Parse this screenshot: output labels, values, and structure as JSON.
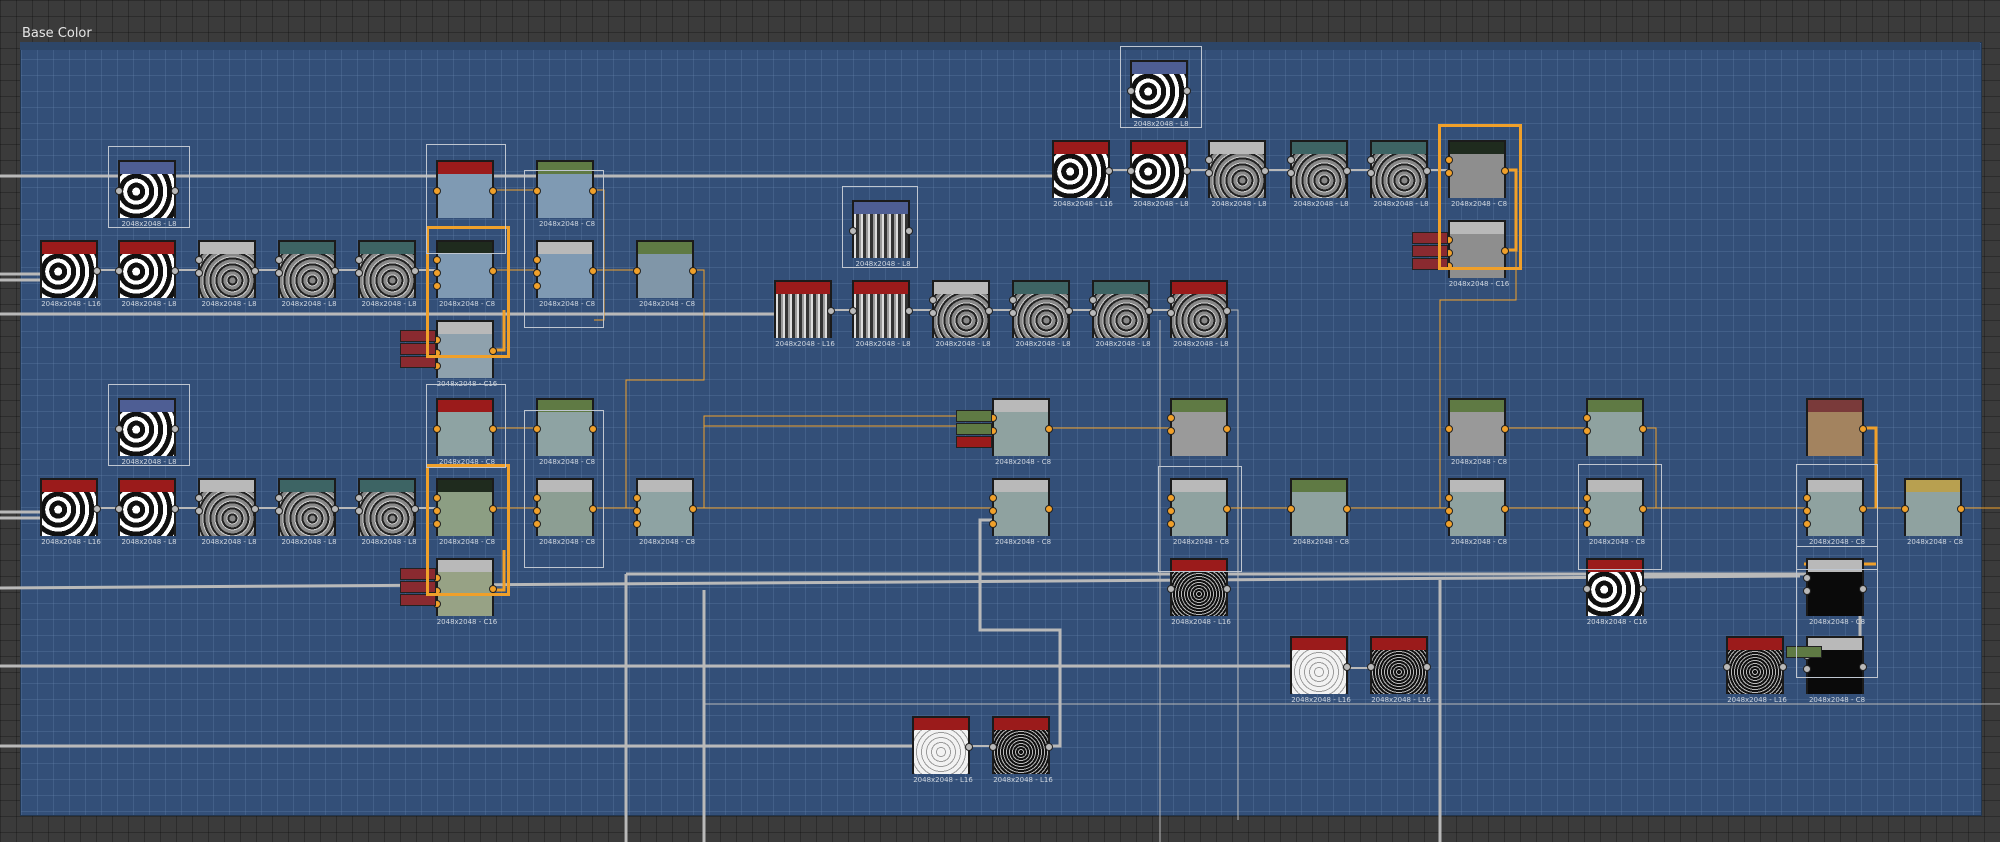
{
  "frame": {
    "title": "Base Color"
  },
  "colors": {
    "frame": "#334f78",
    "header_red": "#9b1b1b",
    "header_teal": "#3d6464",
    "header_gray": "#b9b9b9",
    "header_green": "#5f7a44",
    "header_dark": "#1f2b1e",
    "header_blue": "#4e5e94",
    "header_brown": "#7a3a3a",
    "header_gold": "#b8a050",
    "wire_gray": "#b9b9b9",
    "wire_orange": "#f0a02a"
  },
  "nodes": [
    {
      "id": "n01",
      "label": "2048x2048 - L8",
      "header": "#4e5e94",
      "body": "noise1"
    },
    {
      "id": "n02",
      "label": "2048x2048 - L16",
      "header": "#9b1b1b",
      "body": "noise1"
    },
    {
      "id": "n03",
      "label": "2048x2048 - L8",
      "header": "#9b1b1b",
      "body": "noise1"
    },
    {
      "id": "n04",
      "label": "2048x2048 - L8",
      "header": "#b9b9b9",
      "body": "noise3"
    },
    {
      "id": "n05",
      "label": "2048x2048 - L8",
      "header": "#3d6464",
      "body": "noise3"
    },
    {
      "id": "n06",
      "label": "2048x2048 - L8",
      "header": "#3d6464",
      "body": "noise3"
    },
    {
      "id": "n07",
      "label": "",
      "header": "#9b1b1b",
      "body": "#7f9ab3"
    },
    {
      "id": "n08",
      "label": "2048x2048 - C8",
      "header": "#1f2b1e",
      "body": "#7f9ab3"
    },
    {
      "id": "n09",
      "label": "2048x2048 - C16",
      "header": "#b9b9b9",
      "body": "#8ea1ad"
    },
    {
      "id": "n10",
      "label": "2048x2048 - C8",
      "header": "#5f7a44",
      "body": "#7f9ab3"
    },
    {
      "id": "n11",
      "label": "2048x2048 - C8",
      "header": "#b9b9b9",
      "body": "#7f9ab3"
    },
    {
      "id": "n12",
      "label": "2048x2048 - C8",
      "header": "#5f7a44",
      "body": "#8096a8"
    },
    {
      "id": "n13",
      "label": "2048x2048 - L8",
      "header": "#4e5e94",
      "body": "noise1"
    },
    {
      "id": "n14",
      "label": "2048x2048 - L16",
      "header": "#9b1b1b",
      "body": "noise1"
    },
    {
      "id": "n15",
      "label": "2048x2048 - L8",
      "header": "#9b1b1b",
      "body": "noise1"
    },
    {
      "id": "n16",
      "label": "2048x2048 - L8",
      "header": "#b9b9b9",
      "body": "noise3"
    },
    {
      "id": "n17",
      "label": "2048x2048 - L8",
      "header": "#3d6464",
      "body": "noise3"
    },
    {
      "id": "n18",
      "label": "2048x2048 - L8",
      "header": "#3d6464",
      "body": "noise3"
    },
    {
      "id": "n19",
      "label": "2048x2048 - C8",
      "header": "#9b1b1b",
      "body": "#8ea3a3"
    },
    {
      "id": "n20",
      "label": "2048x2048 - C8",
      "header": "#1f2b1e",
      "body": "#8c9e83"
    },
    {
      "id": "n21",
      "label": "2048x2048 - C16",
      "header": "#b9b9b9",
      "body": "#97a285"
    },
    {
      "id": "n22",
      "label": "2048x2048 - C8",
      "header": "#5f7a44",
      "body": "#8ea3a3"
    },
    {
      "id": "n23",
      "label": "2048x2048 - C8",
      "header": "#b9b9b9",
      "body": "#8c9e93"
    },
    {
      "id": "n24",
      "label": "2048x2048 - C8",
      "header": "#b9b9b9",
      "body": "#8ea3a3"
    },
    {
      "id": "n25",
      "label": "2048x2048 - L8",
      "header": "#4e5e94",
      "body": "noise2"
    },
    {
      "id": "n26",
      "label": "2048x2048 - L16",
      "header": "#9b1b1b",
      "body": "noise2"
    },
    {
      "id": "n27",
      "label": "2048x2048 - L8",
      "header": "#9b1b1b",
      "body": "noise2"
    },
    {
      "id": "n28",
      "label": "2048x2048 - L8",
      "header": "#b9b9b9",
      "body": "noise3"
    },
    {
      "id": "n29",
      "label": "2048x2048 - L8",
      "header": "#3d6464",
      "body": "noise3"
    },
    {
      "id": "n30",
      "label": "2048x2048 - L8",
      "header": "#3d6464",
      "body": "noise3"
    },
    {
      "id": "n31",
      "label": "2048x2048 - L8",
      "header": "#9b1b1b",
      "body": "noise3"
    },
    {
      "id": "n32",
      "label": "2048x2048 - C8",
      "header": "#b9b9b9",
      "body": "#8fa2a0"
    },
    {
      "id": "n33",
      "label": "2048x2048 - C8",
      "header": "#b9b9b9",
      "body": "#8fa2a0"
    },
    {
      "id": "n34",
      "label": "2048x2048 - L8",
      "header": "#4e5e94",
      "body": "noise1"
    },
    {
      "id": "n35",
      "label": "2048x2048 - L16",
      "header": "#9b1b1b",
      "body": "noise1"
    },
    {
      "id": "n36",
      "label": "2048x2048 - L8",
      "header": "#9b1b1b",
      "body": "noise1"
    },
    {
      "id": "n37",
      "label": "2048x2048 - L8",
      "header": "#b9b9b9",
      "body": "noise3"
    },
    {
      "id": "n38",
      "label": "2048x2048 - L8",
      "header": "#3d6464",
      "body": "noise3"
    },
    {
      "id": "n39",
      "label": "2048x2048 - L8",
      "header": "#3d6464",
      "body": "noise3"
    },
    {
      "id": "n40",
      "label": "2048x2048 - C8",
      "header": "#1f2b1e",
      "body": "#8e8e8e"
    },
    {
      "id": "n41",
      "label": "2048x2048 - C16",
      "header": "#b9b9b9",
      "body": "#8e8e8e"
    },
    {
      "id": "n42",
      "label": "",
      "header": "#5f7a44",
      "body": "#9a9a9a"
    },
    {
      "id": "n43",
      "label": "2048x2048 - C8",
      "header": "#b9b9b9",
      "body": "#8fa2a0"
    },
    {
      "id": "n44",
      "label": "2048x2048 - L16",
      "header": "#9b1b1b",
      "body": "noise4"
    },
    {
      "id": "n45",
      "label": "2048x2048 - C8",
      "header": "#5f7a44",
      "body": "#8fa2a0"
    },
    {
      "id": "n46",
      "label": "2048x2048 - L16",
      "header": "#9b1b1b",
      "body": "noise5"
    },
    {
      "id": "n47",
      "label": "2048x2048 - L16",
      "header": "#9b1b1b",
      "body": "noise4"
    },
    {
      "id": "n48",
      "label": "2048x2048 - L16",
      "header": "#9b1b1b",
      "body": "noise5"
    },
    {
      "id": "n49",
      "label": "2048x2048 - L16",
      "header": "#9b1b1b",
      "body": "noise4"
    },
    {
      "id": "n50",
      "label": "2048x2048 - C8",
      "header": "#5f7a44",
      "body": "#999999"
    },
    {
      "id": "n51",
      "label": "2048x2048 - C8",
      "header": "#b9b9b9",
      "body": "#8fa2a0"
    },
    {
      "id": "n52",
      "label": "",
      "header": "#5f7a44",
      "body": "#8fa2a0"
    },
    {
      "id": "n53",
      "label": "2048x2048 - C8",
      "header": "#b9b9b9",
      "body": "#8fa2a0"
    },
    {
      "id": "n54",
      "label": "2048x2048 - C16",
      "header": "#9b1b1b",
      "body": "noise1"
    },
    {
      "id": "n55",
      "label": "",
      "header": "#7a3a3a",
      "body": "#a3835f"
    },
    {
      "id": "n56",
      "label": "2048x2048 - C8",
      "header": "#b9b9b9",
      "body": "#8fa2a0"
    },
    {
      "id": "n57",
      "label": "2048x2048 - C8",
      "header": "#b9b9b9",
      "body": "#0a0a0a"
    },
    {
      "id": "n58",
      "label": "2048x2048 - L16",
      "header": "#9b1b1b",
      "body": "noise4"
    },
    {
      "id": "n59",
      "label": "2048x2048 - C8",
      "header": "#b9b9b9",
      "body": "#0a0a0a"
    },
    {
      "id": "n60",
      "label": "2048x2048 - C8",
      "header": "#b8a050",
      "body": "#8fa2a0"
    }
  ]
}
